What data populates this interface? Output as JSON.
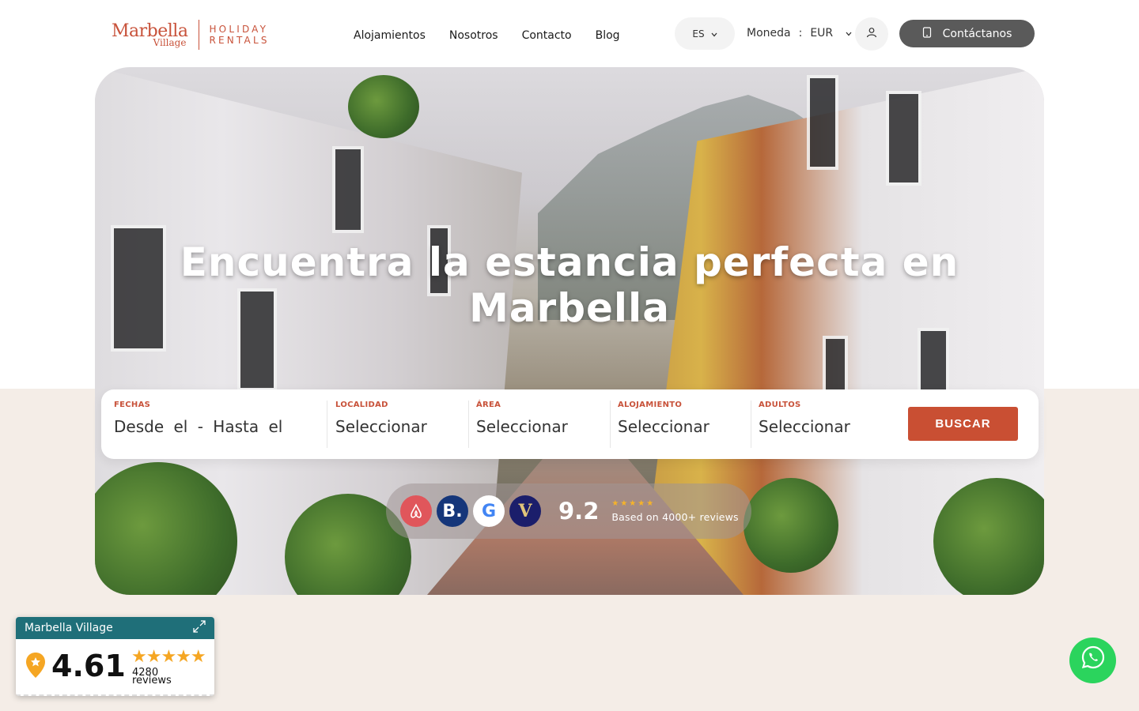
{
  "brand": {
    "script_top": "Marbella",
    "script_bottom": "Village",
    "caps_top": "HOLIDAY",
    "caps_bottom": "RENTALS",
    "color": "#c8523a"
  },
  "nav": {
    "items": [
      "Alojamientos",
      "Nosotros",
      "Contacto",
      "Blog"
    ]
  },
  "header": {
    "language": "ES",
    "language_icon": "chevron-down-icon",
    "currency_label": "Moneda",
    "currency_sep": ":",
    "currency_value": "EUR",
    "user_icon": "user-icon",
    "contact_label": "Contáctanos",
    "contact_icon": "phone-icon"
  },
  "hero": {
    "title": "Encuentra la estancia perfecta en Marbella"
  },
  "search": {
    "fields": [
      {
        "label": "FECHAS",
        "value": "Desde el - Hasta el"
      },
      {
        "label": "LOCALIDAD",
        "value": "Seleccionar"
      },
      {
        "label": "ÁREA",
        "value": "Seleccionar"
      },
      {
        "label": "ALOJAMIENTO",
        "value": "Seleccionar"
      },
      {
        "label": "ADULTOS",
        "value": "Seleccionar"
      }
    ],
    "button_label": "BUSCAR",
    "accent": "#c94f33"
  },
  "reviews_pill": {
    "badges": [
      "airbnb-icon",
      "booking-icon",
      "google-icon",
      "vrbo-icon"
    ],
    "badge_b": "B.",
    "badge_g": "G",
    "badge_v": "V",
    "score": "9.2",
    "stars": "★★★★★",
    "subtitle": "Based on 4000+ reviews"
  },
  "rating_widget": {
    "title": "Marbella Village",
    "score": "4.61",
    "stars": "★★★★★",
    "count": "4280",
    "count_label": "reviews",
    "header_color": "#1f6f79"
  },
  "whatsapp": {
    "icon": "whatsapp-icon",
    "color": "#2bd45d"
  }
}
